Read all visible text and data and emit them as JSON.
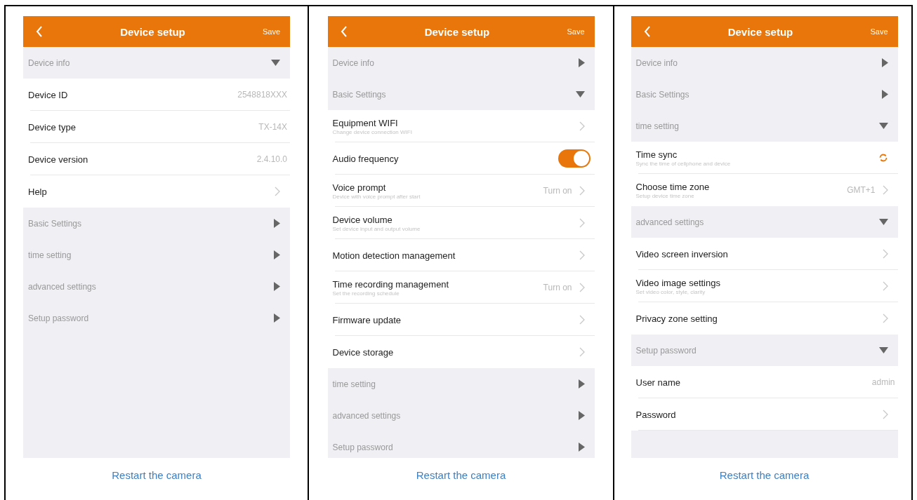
{
  "panels": [
    {
      "header": {
        "title": "Device setup",
        "action": "Save"
      },
      "rows": [
        {
          "kind": "section",
          "label": "Device info",
          "expanded": true
        },
        {
          "kind": "item",
          "label": "Device ID",
          "value": "2548818XXX"
        },
        {
          "kind": "item",
          "label": "Device type",
          "value": "TX-14X"
        },
        {
          "kind": "item",
          "label": "Device version",
          "value": "2.4.10.0"
        },
        {
          "kind": "item",
          "label": "Help",
          "accessory": {
            "kind": "chevron"
          }
        },
        {
          "kind": "section",
          "label": "Basic Settings",
          "expanded": false
        },
        {
          "kind": "section",
          "label": "time setting",
          "expanded": false
        },
        {
          "kind": "section",
          "label": "advanced settings",
          "expanded": false
        },
        {
          "kind": "section",
          "label": "Setup password",
          "expanded": false
        }
      ],
      "link": "Restart the camera"
    },
    {
      "header": {
        "title": "Device setup",
        "action": "Save"
      },
      "rows": [
        {
          "kind": "section",
          "label": "Device info",
          "expanded": false
        },
        {
          "kind": "section",
          "label": "Basic Settings",
          "expanded": true
        },
        {
          "kind": "item",
          "label": "Equipment WIFI",
          "subtitle": "Change device connection WIFI",
          "accessory": {
            "kind": "chevron"
          }
        },
        {
          "kind": "item",
          "label": "Audio frequency",
          "accessory": {
            "kind": "toggle",
            "on": true
          }
        },
        {
          "kind": "item",
          "label": "Voice prompt",
          "subtitle": "Device with voice prompt after start",
          "value": "Turn on",
          "accessory": {
            "kind": "chevron"
          }
        },
        {
          "kind": "item",
          "label": "Device volume",
          "subtitle": "Set device input and output volume",
          "accessory": {
            "kind": "chevron"
          }
        },
        {
          "kind": "item",
          "label": "Motion detection management",
          "accessory": {
            "kind": "chevron"
          }
        },
        {
          "kind": "item",
          "label": "Time recording management",
          "subtitle": "Set the recording schedule",
          "value": "Turn on",
          "accessory": {
            "kind": "chevron"
          }
        },
        {
          "kind": "item",
          "label": "Firmware update",
          "accessory": {
            "kind": "chevron"
          }
        },
        {
          "kind": "item",
          "label": "Device storage",
          "accessory": {
            "kind": "chevron"
          }
        },
        {
          "kind": "section",
          "label": "time setting",
          "expanded": false
        },
        {
          "kind": "section",
          "label": "advanced settings",
          "expanded": false
        },
        {
          "kind": "section",
          "label": "Setup password",
          "expanded": false
        }
      ],
      "link": "Restart the camera"
    },
    {
      "header": {
        "title": "Device setup",
        "action": "Save"
      },
      "rows": [
        {
          "kind": "section",
          "label": "Device info",
          "expanded": false
        },
        {
          "kind": "section",
          "label": "Basic Settings",
          "expanded": false
        },
        {
          "kind": "section",
          "label": "time setting",
          "expanded": true
        },
        {
          "kind": "item",
          "label": "Time sync",
          "subtitle": "Sync the time of cellphone and device",
          "accessory": {
            "kind": "sync"
          }
        },
        {
          "kind": "item",
          "label": "Choose time zone",
          "subtitle": "Setup device time zone",
          "value": "GMT+1",
          "accessory": {
            "kind": "chevron"
          }
        },
        {
          "kind": "section",
          "label": "advanced settings",
          "expanded": true
        },
        {
          "kind": "item",
          "label": "Video screen inversion",
          "accessory": {
            "kind": "chevron"
          }
        },
        {
          "kind": "item",
          "label": "Video image settings",
          "subtitle": "Set video color, style, clarity",
          "accessory": {
            "kind": "chevron"
          }
        },
        {
          "kind": "item",
          "label": "Privacy zone setting",
          "accessory": {
            "kind": "chevron"
          }
        },
        {
          "kind": "section",
          "label": "Setup password",
          "expanded": true
        },
        {
          "kind": "item",
          "label": "User name",
          "value": "admin"
        },
        {
          "kind": "item",
          "label": "Password",
          "accessory": {
            "kind": "chevron"
          }
        }
      ],
      "link": "Restart the camera"
    }
  ]
}
